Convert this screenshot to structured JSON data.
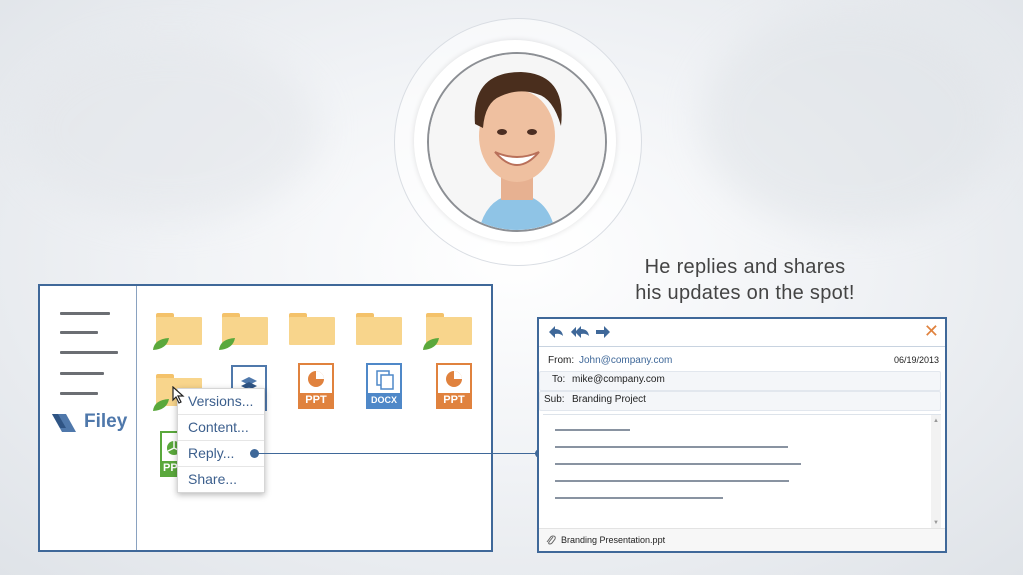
{
  "tagline": {
    "line1": "He replies and shares",
    "line2": "his updates on the spot!"
  },
  "file_manager": {
    "logo_text": "Filey",
    "menu_icon": "hamburger-lines-icon",
    "files": [
      {
        "type": "folder",
        "icon": "folder-icon",
        "shared_leaf": true
      },
      {
        "type": "folder",
        "icon": "folder-icon",
        "shared_leaf": true
      },
      {
        "type": "folder",
        "icon": "folder-icon",
        "shared_leaf": false
      },
      {
        "type": "folder",
        "icon": "folder-icon",
        "shared_leaf": false
      },
      {
        "type": "folder",
        "icon": "folder-icon",
        "shared_leaf": true
      },
      {
        "type": "folder",
        "icon": "folder-icon",
        "shared_leaf": true
      },
      {
        "type": "document",
        "icon": "image-document-icon",
        "label": ""
      },
      {
        "type": "document",
        "icon": "ppt-file-icon",
        "label": "PPT"
      },
      {
        "type": "document",
        "icon": "docx-file-icon",
        "label": "DOCX"
      },
      {
        "type": "document",
        "icon": "ppt-file-icon",
        "label": "PPT"
      },
      {
        "type": "document",
        "icon": "chart-file-icon",
        "label": "PP"
      }
    ],
    "context_menu": [
      "Versions...",
      "Content...",
      "Reply...",
      "Share..."
    ]
  },
  "email": {
    "toolbar": [
      "reply-icon",
      "reply-all-icon",
      "forward-icon",
      "close-icon"
    ],
    "close_glyph": "✕",
    "from_label": "From:",
    "from_value": "John@company.com",
    "date": "06/19/2013",
    "to_label": "To:",
    "to_value": "mike@company.com",
    "sub_label": "Sub:",
    "sub_value": "Branding Project",
    "attachment": "Branding Presentation.ppt"
  },
  "colors": {
    "accent_blue": "#3f6899",
    "folder_yellow": "#f8d58c",
    "ppt_orange": "#e0823e",
    "docx_blue": "#4f88c8",
    "leaf_green": "#5aa83c",
    "close_orange": "#e0823e"
  }
}
